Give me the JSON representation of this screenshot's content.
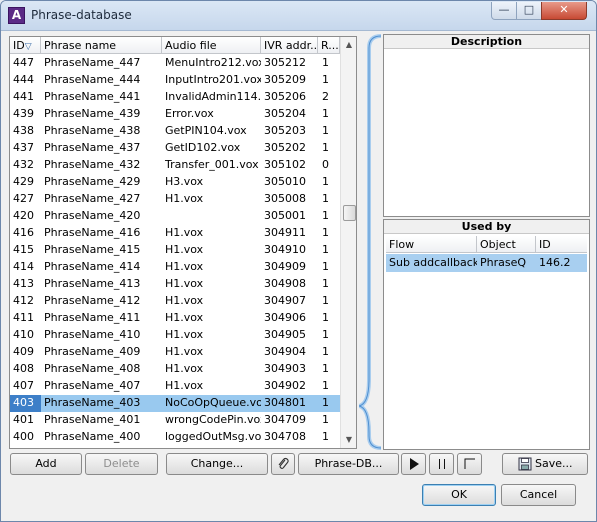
{
  "window": {
    "title": "Phrase-database",
    "app_icon_letter": "A"
  },
  "window_controls": {
    "minimize": "—",
    "maximize": "□",
    "close": "✕"
  },
  "table": {
    "columns": [
      "ID",
      "Phrase name",
      "Audio file",
      "IVR addr...",
      "R..."
    ],
    "sort_indicator": "▽",
    "rows": [
      {
        "id": "447",
        "name": "PhraseName_447",
        "audio": "MenuIntro212.vox",
        "ivr": "305212",
        "r": "1"
      },
      {
        "id": "444",
        "name": "PhraseName_444",
        "audio": "InputIntro201.vox",
        "ivr": "305209",
        "r": "1"
      },
      {
        "id": "441",
        "name": "PhraseName_441",
        "audio": "InvalidAdmin114...",
        "ivr": "305206",
        "r": "2"
      },
      {
        "id": "439",
        "name": "PhraseName_439",
        "audio": "Error.vox",
        "ivr": "305204",
        "r": "1"
      },
      {
        "id": "438",
        "name": "PhraseName_438",
        "audio": "GetPIN104.vox",
        "ivr": "305203",
        "r": "1"
      },
      {
        "id": "437",
        "name": "PhraseName_437",
        "audio": "GetID102.vox",
        "ivr": "305202",
        "r": "1"
      },
      {
        "id": "432",
        "name": "PhraseName_432",
        "audio": "Transfer_001.vox",
        "ivr": "305102",
        "r": "0"
      },
      {
        "id": "429",
        "name": "PhraseName_429",
        "audio": "H3.vox",
        "ivr": "305010",
        "r": "1"
      },
      {
        "id": "427",
        "name": "PhraseName_427",
        "audio": "H1.vox",
        "ivr": "305008",
        "r": "1"
      },
      {
        "id": "420",
        "name": "PhraseName_420",
        "audio": "",
        "ivr": "305001",
        "r": "1"
      },
      {
        "id": "416",
        "name": "PhraseName_416",
        "audio": "H1.vox",
        "ivr": "304911",
        "r": "1"
      },
      {
        "id": "415",
        "name": "PhraseName_415",
        "audio": "H1.vox",
        "ivr": "304910",
        "r": "1"
      },
      {
        "id": "414",
        "name": "PhraseName_414",
        "audio": "H1.vox",
        "ivr": "304909",
        "r": "1"
      },
      {
        "id": "413",
        "name": "PhraseName_413",
        "audio": "H1.vox",
        "ivr": "304908",
        "r": "1"
      },
      {
        "id": "412",
        "name": "PhraseName_412",
        "audio": "H1.vox",
        "ivr": "304907",
        "r": "1"
      },
      {
        "id": "411",
        "name": "PhraseName_411",
        "audio": "H1.vox",
        "ivr": "304906",
        "r": "1"
      },
      {
        "id": "410",
        "name": "PhraseName_410",
        "audio": "H1.vox",
        "ivr": "304905",
        "r": "1"
      },
      {
        "id": "409",
        "name": "PhraseName_409",
        "audio": "H1.vox",
        "ivr": "304904",
        "r": "1"
      },
      {
        "id": "408",
        "name": "PhraseName_408",
        "audio": "H1.vox",
        "ivr": "304903",
        "r": "1"
      },
      {
        "id": "407",
        "name": "PhraseName_407",
        "audio": "H1.vox",
        "ivr": "304902",
        "r": "1"
      },
      {
        "id": "403",
        "name": "PhraseName_403",
        "audio": "NoCoOpQueue.vox",
        "ivr": "304801",
        "r": "1",
        "selected": true
      },
      {
        "id": "401",
        "name": "PhraseName_401",
        "audio": "wrongCodePin.vox",
        "ivr": "304709",
        "r": "1"
      },
      {
        "id": "400",
        "name": "PhraseName_400",
        "audio": "loggedOutMsg.vox",
        "ivr": "304708",
        "r": "1"
      }
    ]
  },
  "description": {
    "header": "Description"
  },
  "used_by": {
    "header": "Used by",
    "columns": [
      "Flow",
      "Object",
      "ID"
    ],
    "rows": [
      {
        "flow": "Sub addcallback...",
        "object": "PhraseQ",
        "id": "146.2"
      }
    ]
  },
  "toolbar": {
    "add": "Add",
    "delete": "Delete",
    "change": "Change...",
    "link_icon": "paperclip-icon",
    "phrase_db": "Phrase-DB...",
    "play_icon": "play-icon",
    "pause_icon": "pause-icon",
    "stop_icon": "stop-icon",
    "save": "Save...",
    "save_icon": "save-disk-icon"
  },
  "dialog": {
    "ok": "OK",
    "cancel": "Cancel"
  },
  "colors": {
    "selection": "#99c9ef",
    "selection_id": "#3d7fc8",
    "accent": "#3c7fb1"
  }
}
